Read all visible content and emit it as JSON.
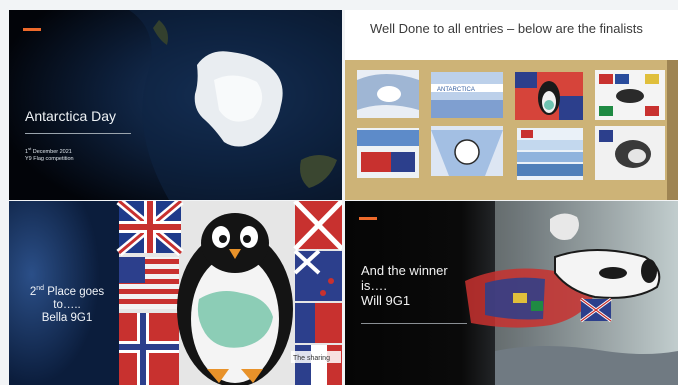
{
  "slide1": {
    "title": "Antarctica Day",
    "date_num": "1",
    "date_sup": "st",
    "date_rest": " December 2021",
    "subtitle": "Y9 Flag competition"
  },
  "slide2": {
    "title": "Well Done to all entries – below are the finalists"
  },
  "slide3": {
    "place_num": "2",
    "place_sup": "nd",
    "line1_rest": " Place goes",
    "line2": "to…..",
    "line3": "Bella 9G1"
  },
  "slide4": {
    "line1": "And the winner",
    "line2": "is….",
    "line3": "Will 9G1"
  },
  "colors": {
    "accent": "#ee6a2b",
    "dark_navy": "#10284e"
  }
}
